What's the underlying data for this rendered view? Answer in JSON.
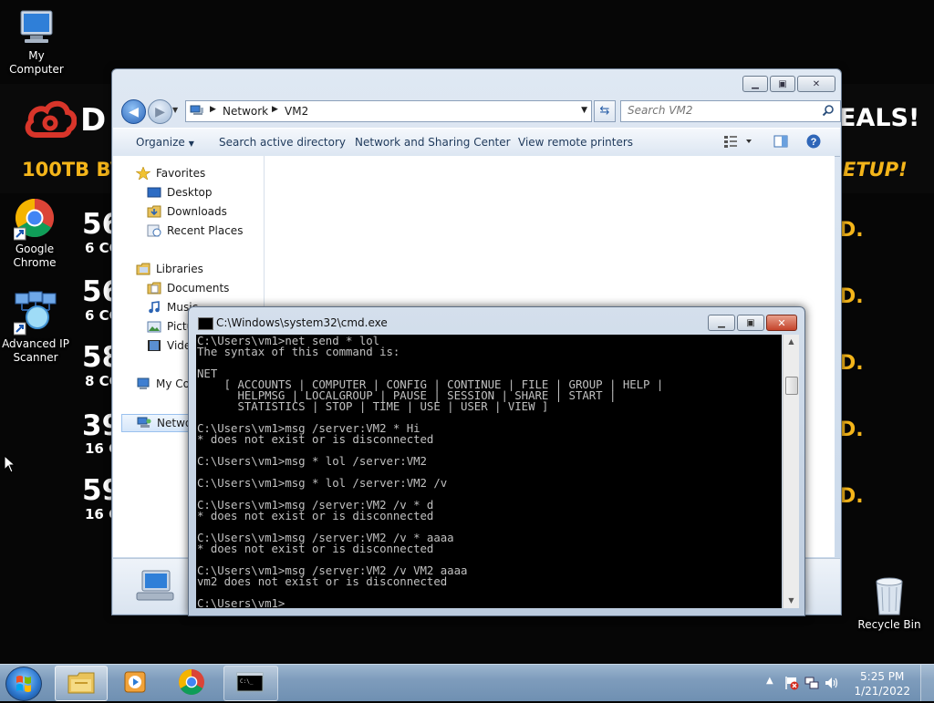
{
  "desktop": {
    "icons": [
      {
        "label": "My Computer"
      },
      {
        "label": "Google Chrome"
      },
      {
        "label": "Advanced IP Scanner"
      },
      {
        "label": "Recycle Bin"
      }
    ],
    "wallpaper": {
      "brand": "D",
      "headline_right": "EALS!",
      "sub_left": "100TB BV",
      "sub_right": "ETUP!",
      "rows": [
        {
          "num": "56",
          "sub": "6 CC"
        },
        {
          "num": "56",
          "sub": "6 CC"
        },
        {
          "num": "58",
          "sub": "8 CC"
        },
        {
          "num": "39",
          "sub": "16 C"
        },
        {
          "num": "59",
          "sub": "16 C"
        }
      ],
      "dot": "D.",
      "accent": "#f4b51a",
      "logo_color": "#d8352a"
    }
  },
  "explorer": {
    "address": {
      "crumbs": [
        "Network",
        "VM2"
      ]
    },
    "search": {
      "placeholder": "Search VM2"
    },
    "commands": [
      {
        "label": "Organize"
      },
      {
        "label": "Search active directory"
      },
      {
        "label": "Network and Sharing Center"
      },
      {
        "label": "View remote printers"
      }
    ],
    "nav": {
      "favorites": {
        "label": "Favorites",
        "items": [
          "Desktop",
          "Downloads",
          "Recent Places"
        ]
      },
      "libraries": {
        "label": "Libraries",
        "items": [
          "Documents",
          "Music",
          "Pictures",
          "Videos"
        ]
      },
      "computer": {
        "label": "My Computer"
      },
      "network": {
        "label": "Network"
      }
    }
  },
  "cmd": {
    "title": "C:\\Windows\\system32\\cmd.exe",
    "lines": [
      "C:\\Users\\vm1>net send * lol",
      "The syntax of this command is:",
      "",
      "NET",
      "    [ ACCOUNTS | COMPUTER | CONFIG | CONTINUE | FILE | GROUP | HELP |",
      "      HELPMSG | LOCALGROUP | PAUSE | SESSION | SHARE | START |",
      "      STATISTICS | STOP | TIME | USE | USER | VIEW ]",
      "",
      "C:\\Users\\vm1>msg /server:VM2 * Hi",
      "* does not exist or is disconnected",
      "",
      "C:\\Users\\vm1>msg * lol /server:VM2",
      "",
      "C:\\Users\\vm1>msg * lol /server:VM2 /v",
      "",
      "C:\\Users\\vm1>msg /server:VM2 /v * d",
      "* does not exist or is disconnected",
      "",
      "C:\\Users\\vm1>msg /server:VM2 /v * aaaa",
      "* does not exist or is disconnected",
      "",
      "C:\\Users\\vm1>msg /server:VM2 /v VM2 aaaa",
      "vm2 does not exist or is disconnected",
      "",
      "C:\\Users\\vm1>"
    ],
    "scroll_position": 0.12
  },
  "taskbar": {
    "items": [
      {
        "icon": "windows-explorer-icon",
        "state": "active"
      },
      {
        "icon": "media-player-icon",
        "state": "normal"
      },
      {
        "icon": "chrome-icon",
        "state": "normal"
      },
      {
        "icon": "cmd-icon",
        "state": "highlighted"
      }
    ],
    "clock": {
      "time": "5:25 PM",
      "date": "1/21/2022"
    }
  }
}
